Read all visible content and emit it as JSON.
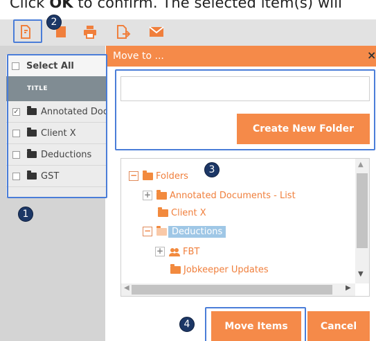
{
  "instruction": {
    "prefix": "Click ",
    "ok": "OK",
    "suffix": " to confirm. The selected item(s) will"
  },
  "toolbar": {
    "icons": [
      "move-doc-icon",
      "bookmark-icon",
      "print-icon",
      "export-doc-icon",
      "email-icon"
    ]
  },
  "table": {
    "select_all_label": "Select All",
    "column_title": "TITLE",
    "rows": [
      {
        "title": "Annotated Documents - List",
        "checked": true
      },
      {
        "title": "Client X",
        "checked": false
      },
      {
        "title": "Deductions",
        "checked": false
      },
      {
        "title": "GST",
        "checked": false
      }
    ]
  },
  "modal": {
    "title": "Move to ...",
    "close_label": "×",
    "folder_input_value": "",
    "create_button_label": "Create New Folder",
    "tree": {
      "root": "Folders",
      "items": [
        {
          "label": "Annotated Documents - List",
          "toggle": "+"
        },
        {
          "label": "Client X",
          "toggle": ""
        },
        {
          "label": "Deductions",
          "toggle": "−",
          "selected": true
        },
        {
          "label": "FBT",
          "toggle": "+"
        },
        {
          "label": "Jobkeeper Updates",
          "toggle": ""
        }
      ]
    },
    "move_button_label": "Move Items",
    "cancel_button_label": "Cancel"
  },
  "callouts": [
    "1",
    "2",
    "3",
    "4"
  ],
  "colors": {
    "accent": "#f58a49",
    "highlight_border": "#4a7dd8",
    "callout_bg": "#1c3766",
    "selected_node": "#9fc7e6"
  }
}
